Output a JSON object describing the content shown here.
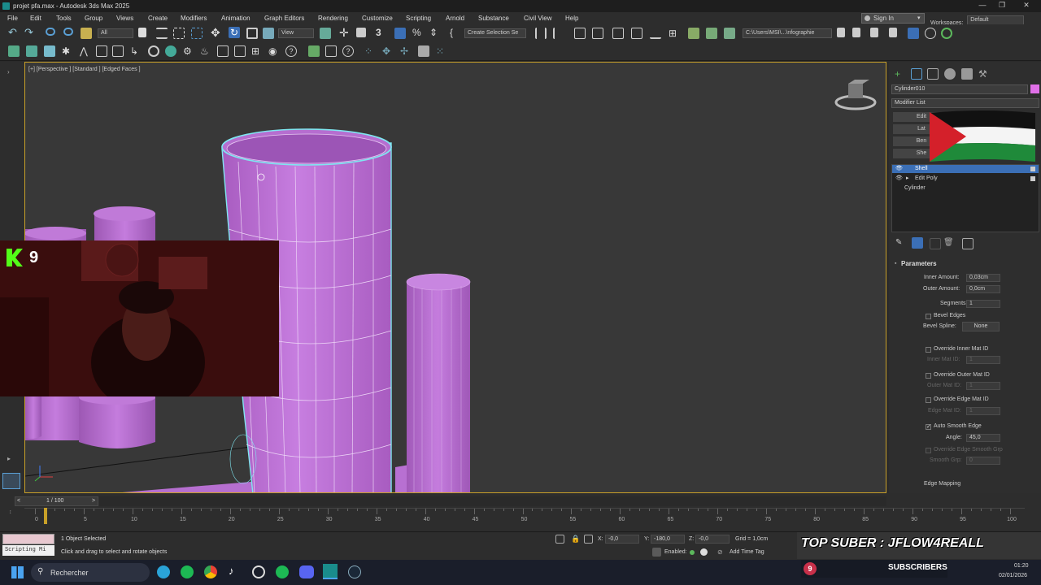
{
  "window": {
    "title": "projet pfa.max - Autodesk 3ds Max 2025",
    "minimize": "—",
    "maximize": "❐",
    "close": "✕"
  },
  "menubar": {
    "items": [
      "File",
      "Edit",
      "Tools",
      "Group",
      "Views",
      "Create",
      "Modifiers",
      "Animation",
      "Graph Editors",
      "Rendering",
      "Customize",
      "Scripting",
      "Arnold",
      "Substance",
      "Civil View",
      "Help"
    ],
    "signin": "Sign In",
    "workspaces_label": "Workspaces:",
    "workspaces_value": "Default"
  },
  "toolbar": {
    "filter": "All",
    "ref_coord": "View",
    "selection_set": "Create Selection Se",
    "path": "C:\\Users\\MSI\\...\\nfographie"
  },
  "viewport": {
    "label": "[+] [Perspective ] [Standard ] [Edged Faces ]"
  },
  "webcam": {
    "kick_count": "9"
  },
  "command_panel": {
    "object_name": "Cylinder010",
    "object_color": "#e070e8",
    "modifier_list": "Modifier List",
    "modifier_buttons": [
      "Edit",
      "Lat",
      "Ben",
      "She"
    ],
    "stack": [
      "Shell",
      "Edit Poly",
      "Cylinder"
    ],
    "rollout_title": "Parameters",
    "inner_amount_label": "Inner Amount:",
    "inner_amount": "0,03cm",
    "outer_amount_label": "Outer Amount:",
    "outer_amount": "0,0cm",
    "segments_label": "Segments:",
    "segments": "1",
    "bevel_edges": "Bevel Edges",
    "bevel_spline_label": "Bevel Spline:",
    "bevel_spline": "None",
    "override_inner": "Override Inner Mat ID",
    "inner_mat_label": "Inner Mat ID:",
    "inner_mat": "1",
    "override_outer": "Override Outer Mat ID",
    "outer_mat_label": "Outer Mat ID:",
    "outer_mat": "1",
    "override_edge": "Override Edge Mat ID",
    "edge_mat_label": "Edge Mat ID:",
    "edge_mat": "1",
    "auto_smooth": "Auto Smooth Edge",
    "angle_label": "Angle:",
    "angle": "45,0",
    "override_smooth": "Override Edge Smooth Grp",
    "smooth_grp_label": "Smooth Grp:",
    "smooth_grp": "0",
    "edge_mapping": "Edge Mapping"
  },
  "timeline": {
    "frame": "1 / 100",
    "prev": "<",
    "next": ">",
    "ticks": [
      "0",
      "5",
      "10",
      "15",
      "20",
      "25",
      "30",
      "35",
      "40",
      "45",
      "50",
      "55",
      "60",
      "65",
      "70",
      "75",
      "80",
      "85",
      "90",
      "95",
      "100"
    ]
  },
  "status": {
    "selected": "1 Object Selected",
    "prompt": "Click and drag to select and rotate objects",
    "script": "Scripting Mi",
    "x_label": "X:",
    "x": "-0,0",
    "y_label": "Y:",
    "y": "-180,0",
    "z_label": "Z:",
    "z": "-0,0",
    "grid": "Grid = 1,0cm",
    "enabled": "Enabled:",
    "add_time_tag": "Add Time Tag",
    "overlay_top": "TOP SUBER : JFLOW4REALL",
    "overlay_subs": "SUBSCRIBERS",
    "overlay_badge": "9"
  },
  "taskbar": {
    "search": "Rechercher",
    "time": "01:20",
    "date": "02/01/2026"
  },
  "colors": {
    "accent": "#c8a028",
    "selection": "#3b6fb6",
    "shell": "#b86fcf",
    "mesh": "#c77ee0"
  }
}
